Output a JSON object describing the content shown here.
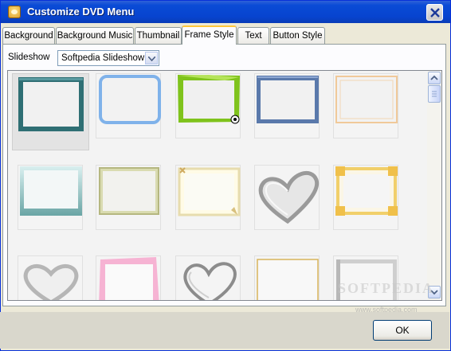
{
  "window": {
    "title": "Customize DVD Menu",
    "app_icon": "dvd-menu-icon",
    "close_icon": "close-icon"
  },
  "tabs": [
    {
      "label": "Background",
      "active": false
    },
    {
      "label": "Background Music",
      "active": false
    },
    {
      "label": "Thumbnail",
      "active": false
    },
    {
      "label": "Frame Style",
      "active": true
    },
    {
      "label": "Text",
      "active": false
    },
    {
      "label": "Button Style",
      "active": false
    }
  ],
  "slideshow": {
    "label": "Slideshow",
    "selected": "Softpedia Slideshow"
  },
  "frames": [
    {
      "style": "teal-wood",
      "selected": true
    },
    {
      "style": "blue-rounded",
      "selected": false
    },
    {
      "style": "green-torn-soccer",
      "selected": false
    },
    {
      "style": "blue-stone",
      "selected": false
    },
    {
      "style": "peach-simple",
      "selected": false
    },
    {
      "style": "teal-gradient",
      "selected": false
    },
    {
      "style": "olive-classic",
      "selected": false
    },
    {
      "style": "cream-bow",
      "selected": false
    },
    {
      "style": "silver-heart",
      "selected": false
    },
    {
      "style": "gold-corners",
      "selected": false
    },
    {
      "style": "silver-heart-2",
      "selected": false
    },
    {
      "style": "pink-tilted",
      "selected": false
    },
    {
      "style": "chrome-heart",
      "selected": false
    },
    {
      "style": "gold-thin",
      "selected": false
    },
    {
      "style": "gray-bevel",
      "selected": false
    }
  ],
  "watermark": {
    "text": "SOFTPEDIA",
    "sub": "www.softpedia.com"
  },
  "ok_button": "OK",
  "colors": {
    "titlebar": "#0a4bd6",
    "active_tab_accent": "#ffc73c"
  }
}
